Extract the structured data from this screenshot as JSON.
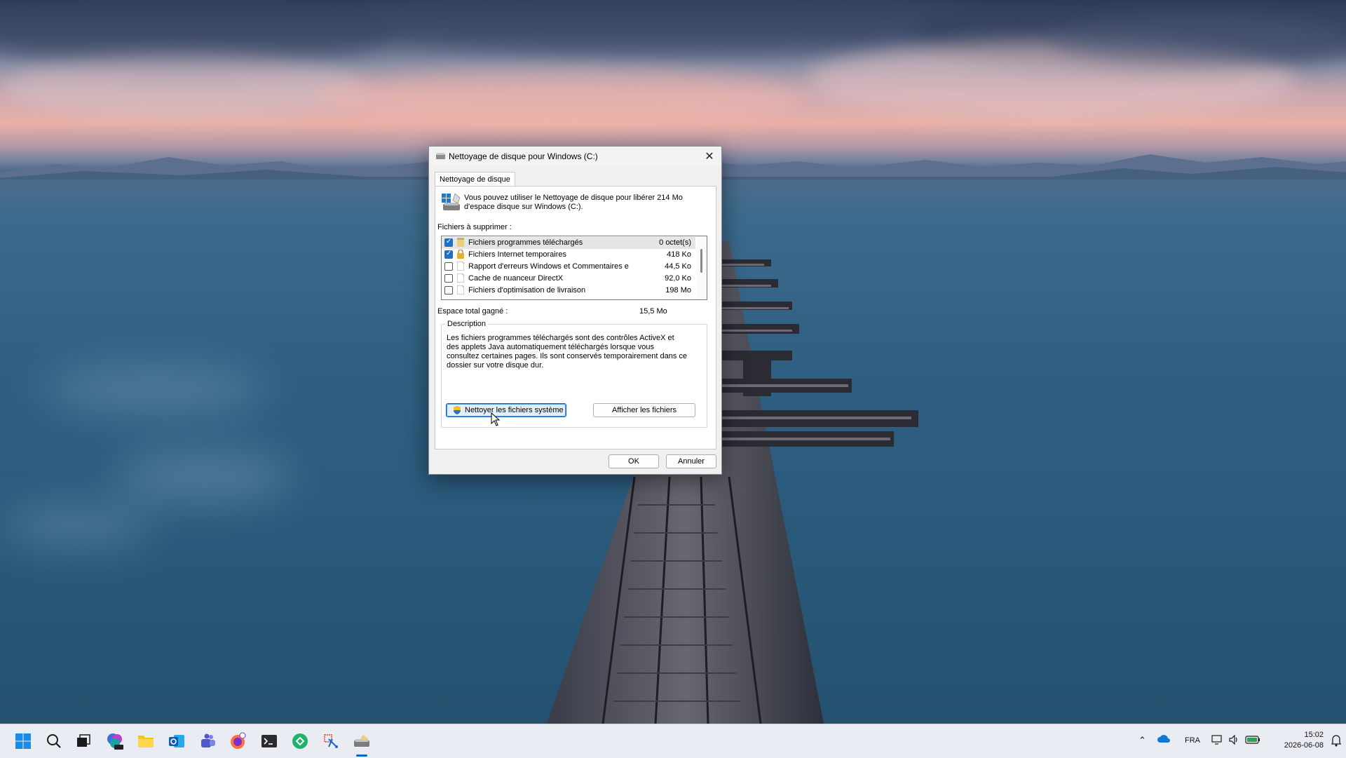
{
  "dialog": {
    "title": "Nettoyage de disque pour Windows (C:)",
    "tab": "Nettoyage de disque",
    "intro": "Vous pouvez utiliser le Nettoyage de disque pour libérer 214 Mo d'espace disque sur Windows (C:).",
    "files_label": "Fichiers à supprimer :",
    "files": [
      {
        "name": "Fichiers programmes téléchargés",
        "size": "0 octet(s)",
        "checked": true,
        "selected": true,
        "icon": "folder-icon"
      },
      {
        "name": "Fichiers Internet temporaires",
        "size": "418 Ko",
        "checked": true,
        "selected": false,
        "icon": "lock-icon"
      },
      {
        "name": "Rapport d'erreurs Windows et Commentaires e...",
        "size": "44,5 Ko",
        "checked": false,
        "selected": false,
        "icon": "file-icon"
      },
      {
        "name": "Cache de nuanceur DirectX",
        "size": "92,0 Ko",
        "checked": false,
        "selected": false,
        "icon": "file-icon"
      },
      {
        "name": "Fichiers d'optimisation de livraison",
        "size": "198 Mo",
        "checked": false,
        "selected": false,
        "icon": "file-icon"
      }
    ],
    "total_label": "Espace total gagné :",
    "total_value": "15,5 Mo",
    "description_legend": "Description",
    "description_text": "Les fichiers programmes téléchargés sont des contrôles ActiveX et des applets Java automatiquement téléchargés lorsque vous consultez certaines pages. Ils sont conservés temporairement dans ce dossier sur votre disque dur.",
    "clean_system_button": "Nettoyer les fichiers système",
    "view_files_button": "Afficher les fichiers",
    "ok_button": "OK",
    "cancel_button": "Annuler"
  },
  "taskbar": {
    "icons": [
      "windows-start-icon",
      "search-icon",
      "task-view-icon",
      "microsoft-365-icon",
      "file-explorer-icon",
      "outlook-icon",
      "teams-icon",
      "firefox-icon",
      "terminal-icon",
      "sync-app-icon",
      "snipping-tool-icon",
      "disk-cleanup-icon"
    ],
    "tray": {
      "language": "FRA",
      "time": "15:02",
      "date": "2026-06-08"
    }
  },
  "colors": {
    "accent": "#0067c0",
    "checkbox": "#1f6fc5"
  }
}
